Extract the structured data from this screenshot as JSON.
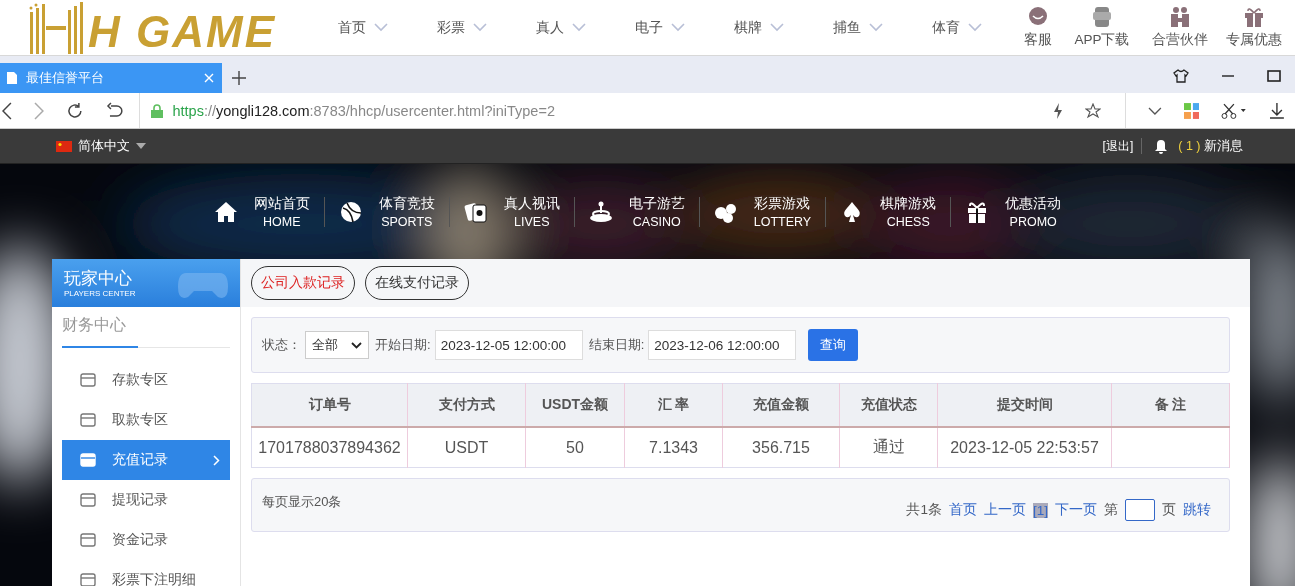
{
  "site_header": {
    "logo_text": "H GAME",
    "nav": [
      {
        "label": "首页"
      },
      {
        "label": "彩票"
      },
      {
        "label": "真人"
      },
      {
        "label": "电子"
      },
      {
        "label": "棋牌"
      },
      {
        "label": "捕鱼"
      },
      {
        "label": "体育"
      }
    ],
    "shortcuts": [
      {
        "label": "客服"
      },
      {
        "label": "APP下载"
      },
      {
        "label": "合营伙伴"
      },
      {
        "label": "专属优惠"
      }
    ]
  },
  "browser": {
    "tabs": [
      {
        "title": "最佳信誉平台",
        "selected": true
      }
    ],
    "url_scheme": "https",
    "url_sep": "://",
    "url_host": "yongli128.com",
    "url_rest": ":8783/hhcp/usercenter.html?iniType=2"
  },
  "top_bar": {
    "language": "简体中文",
    "logout": "[退出]",
    "message_count": "( 1 )",
    "message_label": "新消息"
  },
  "main_nav": [
    {
      "title": "网站首页",
      "subtitle": "HOME"
    },
    {
      "title": "体育竞技",
      "subtitle": "SPORTS"
    },
    {
      "title": "真人视讯",
      "subtitle": "LIVES"
    },
    {
      "title": "电子游艺",
      "subtitle": "CASINO"
    },
    {
      "title": "彩票游戏",
      "subtitle": "LOTTERY"
    },
    {
      "title": "棋牌游戏",
      "subtitle": "CHESS"
    },
    {
      "title": "优惠活动",
      "subtitle": "PROMO"
    }
  ],
  "sidebar": {
    "title": "玩家中心",
    "subtitle": "PLAYERS CENTER",
    "section": "财务中心",
    "items": [
      {
        "label": "存款专区",
        "selected": false
      },
      {
        "label": "取款专区",
        "selected": false
      },
      {
        "label": "充值记录",
        "selected": true
      },
      {
        "label": "提现记录",
        "selected": false
      },
      {
        "label": "资金记录",
        "selected": false
      },
      {
        "label": "彩票下注明细",
        "selected": false
      }
    ]
  },
  "record_tabs": [
    {
      "label": "公司入款记录",
      "selected": true
    },
    {
      "label": "在线支付记录",
      "selected": false
    }
  ],
  "filter": {
    "status_label": "状态：",
    "status_value": "全部",
    "start_label": "开始日期:",
    "start_value": "2023-12-05 12:00:00",
    "end_label": "结束日期:",
    "end_value": "2023-12-06 12:00:00",
    "button": "查询"
  },
  "table": {
    "columns": [
      "订单号",
      "支付方式",
      "USDT金额",
      "汇 率",
      "充值金额",
      "充值状态",
      "提交时间",
      "备 注"
    ],
    "rows": [
      [
        "1701788037894362",
        "USDT",
        "50",
        "7.1343",
        "356.715",
        "通过",
        "2023-12-05 22:53:57",
        ""
      ]
    ]
  },
  "footer": {
    "per_page": "每页显示20条",
    "total": "共1条",
    "first": "首页",
    "prev": "上一页",
    "current": "[1]",
    "next": "下一页",
    "goto_prefix": "第",
    "goto_suffix": "页",
    "jump": "跳转"
  }
}
